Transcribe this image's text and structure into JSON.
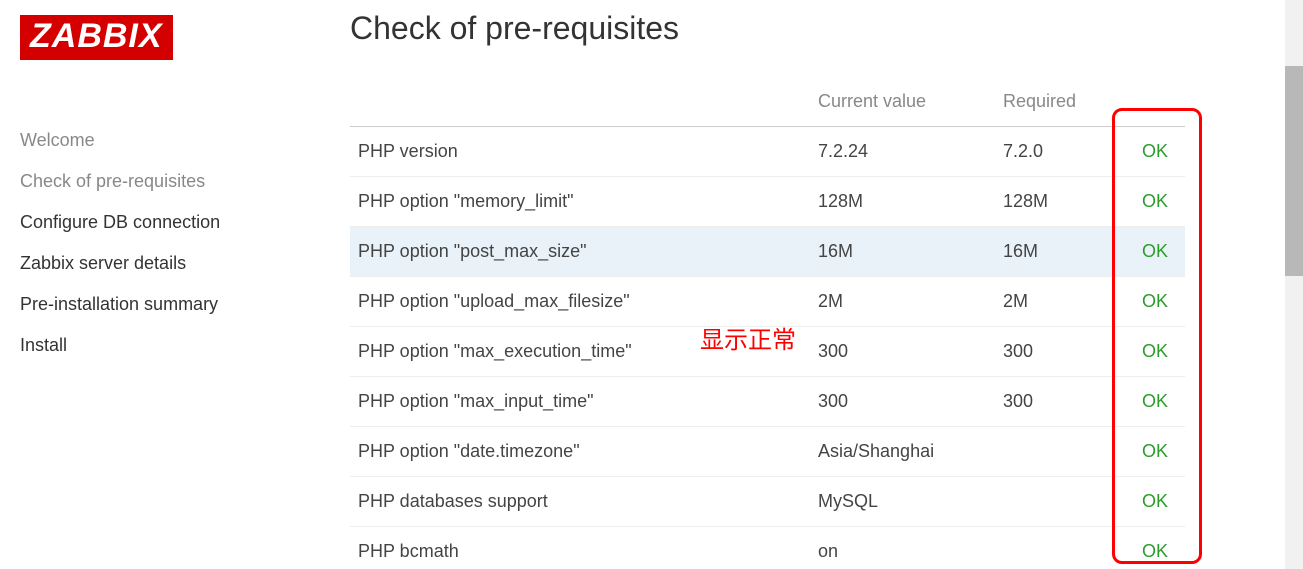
{
  "brand": "ZABBIX",
  "page_title": "Check of pre-requisites",
  "sidebar": {
    "items": [
      {
        "label": "Welcome",
        "active": true
      },
      {
        "label": "Check of pre-requisites",
        "active": true
      },
      {
        "label": "Configure DB connection",
        "active": false
      },
      {
        "label": "Zabbix server details",
        "active": false
      },
      {
        "label": "Pre-installation summary",
        "active": false
      },
      {
        "label": "Install",
        "active": false
      }
    ]
  },
  "table": {
    "headers": {
      "name": "",
      "current": "Current value",
      "required": "Required",
      "status": ""
    },
    "rows": [
      {
        "name": "PHP version",
        "current": "7.2.24",
        "required": "7.2.0",
        "status": "OK",
        "highlight": false
      },
      {
        "name": "PHP option \"memory_limit\"",
        "current": "128M",
        "required": "128M",
        "status": "OK",
        "highlight": false
      },
      {
        "name": "PHP option \"post_max_size\"",
        "current": "16M",
        "required": "16M",
        "status": "OK",
        "highlight": true
      },
      {
        "name": "PHP option \"upload_max_filesize\"",
        "current": "2M",
        "required": "2M",
        "status": "OK",
        "highlight": false
      },
      {
        "name": "PHP option \"max_execution_time\"",
        "current": "300",
        "required": "300",
        "status": "OK",
        "highlight": false
      },
      {
        "name": "PHP option \"max_input_time\"",
        "current": "300",
        "required": "300",
        "status": "OK",
        "highlight": false
      },
      {
        "name": "PHP option \"date.timezone\"",
        "current": "Asia/Shanghai",
        "required": "",
        "status": "OK",
        "highlight": false
      },
      {
        "name": "PHP databases support",
        "current": "MySQL",
        "required": "",
        "status": "OK",
        "highlight": false
      },
      {
        "name": "PHP bcmath",
        "current": "on",
        "required": "",
        "status": "OK",
        "highlight": false
      }
    ]
  },
  "annotation_text": "显示正常"
}
